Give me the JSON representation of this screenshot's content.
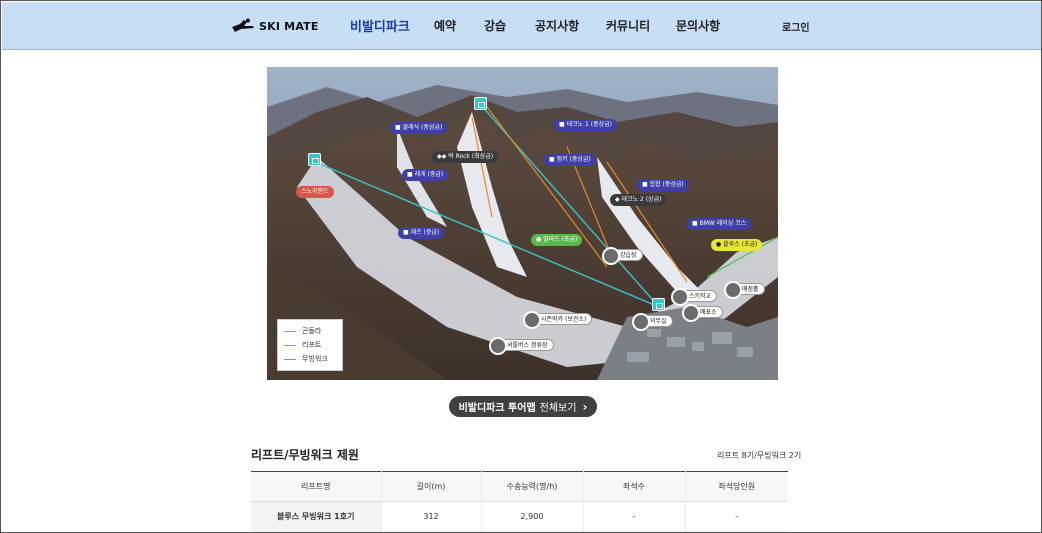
{
  "header": {
    "logo_text": "SKI MATE",
    "nav": [
      "비발디파크",
      "예약",
      "강습",
      "공지사항",
      "커뮤니티",
      "문의사항"
    ],
    "login": "로그인"
  },
  "map": {
    "labels": {
      "classic": "■ 클래식 (중상급)",
      "techno1": "■ 테크노 1 (중상급)",
      "rock": "◆◆ 락 Rock (최상급)",
      "funky": "■ 펑키 (중상급)",
      "reggae": "■ 레게 (중급)",
      "hiphop": "■ 힙합 (중상급)",
      "techno2": "◆ 테크노 2 (상급)",
      "snowworld": "스노위랜드",
      "bmw": "■ BMW 레이싱 코스",
      "jazz": "■ 재즈 (중급)",
      "ballad": "● 발라드 (초급)",
      "blues": "● 블루스 (초급)",
      "lesson": "강습장",
      "skischool": "스키학교",
      "medical": "의무실",
      "rental": "렌탈소",
      "office": "매표소",
      "season": "시즌락카 (보관소)",
      "shuttle": "셔틀버스 정류장"
    },
    "legend": [
      {
        "label": "곤돌라",
        "color": "#39c4c8"
      },
      {
        "label": "리프트",
        "color": "#e8882b"
      },
      {
        "label": "무빙워크",
        "color": "#4cc04a"
      }
    ]
  },
  "tour": {
    "bold": "비발디파크 투어맵",
    "light": "전체보기",
    "arrow": "›"
  },
  "spec": {
    "title": "리프트/무빙워크 제원",
    "meta": "리프트 8기/무빙워크 2기",
    "headers": [
      "리프트명",
      "길이(m)",
      "수송능력(명/h)",
      "좌석수",
      "좌석당인원"
    ],
    "rows": [
      [
        "블루스 무빙워크 1호기",
        "312",
        "2,900",
        "-",
        "-"
      ]
    ]
  }
}
